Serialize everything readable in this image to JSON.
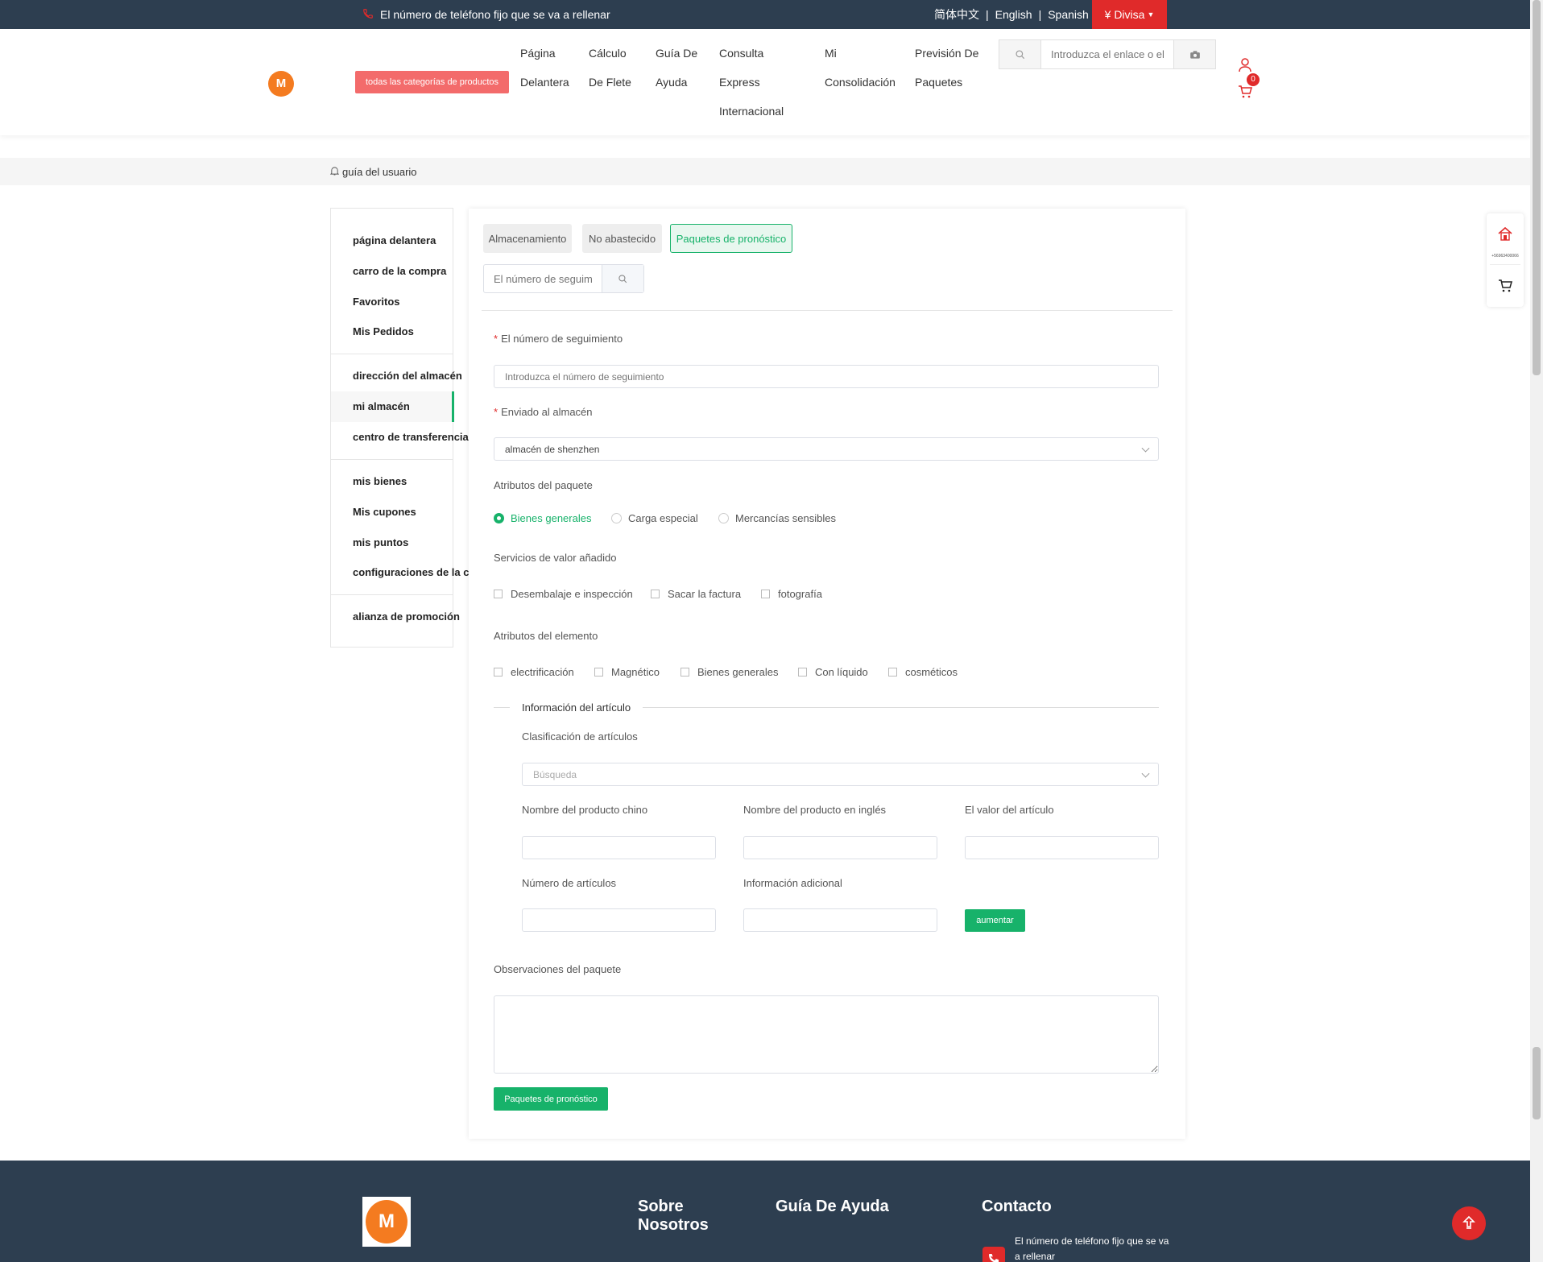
{
  "topbar": {
    "phone_text": "El número de teléfono fijo que se va a rellenar",
    "lang_zh": "简体中文",
    "lang_en": "English",
    "lang_es": "Spanish",
    "currency": "¥ Divisa"
  },
  "header": {
    "all_categories": "todas las categorías de productos",
    "nav": [
      {
        "line1": "Página",
        "line2": "Delantera",
        "line3": ""
      },
      {
        "line1": "Cálculo",
        "line2": "De Flete",
        "line3": ""
      },
      {
        "line1": "Guía De",
        "line2": "Ayuda",
        "line3": ""
      },
      {
        "line1": "Consulta",
        "line2": "Express",
        "line3": "Internacional"
      },
      {
        "line1": "Mi",
        "line2": "Consolidación",
        "line3": ""
      },
      {
        "line1": "Previsión De",
        "line2": "Paquetes",
        "line3": ""
      }
    ],
    "search_placeholder": "Introduzca el enlace o el",
    "cart_count": "0"
  },
  "breadcrumb": {
    "label": "guía del usuario"
  },
  "sidebar": {
    "items": [
      "página delantera",
      "carro de la compra",
      "Favoritos",
      "Mis Pedidos",
      "dirección del almacén",
      "mi almacén",
      "centro de transferencia",
      "mis bienes",
      "Mis cupones",
      "mis puntos",
      "configuraciones de la cuenta",
      "alianza de promoción"
    ],
    "active": "mi almacén"
  },
  "tabs": [
    "Almacenamiento",
    "No abastecido",
    "Paquetes de pronóstico"
  ],
  "tracking_search_placeholder": "El número de seguim",
  "form": {
    "tracking_label": "El número de seguimiento",
    "tracking_placeholder": "Introduzca el número de seguimiento",
    "warehouse_label": "Enviado al almacén",
    "warehouse_value": "almacén de shenzhen",
    "package_attr_label": "Atributos del paquete",
    "package_attrs": [
      "Bienes generales",
      "Carga especial",
      "Mercancías sensibles"
    ],
    "package_attr_selected": "Bienes generales",
    "services_label": "Servicios de valor añadido",
    "services": [
      "Desembalaje e inspección",
      "Sacar la factura",
      "fotografía"
    ],
    "item_attr_label": "Atributos del elemento",
    "item_attrs": [
      "electrificación",
      "Magnético",
      "Bienes generales",
      "Con líquido",
      "cosméticos"
    ],
    "item_info_title": "Información del artículo",
    "classification_label": "Clasificación de artículos",
    "classification_placeholder": "Búsqueda",
    "cn_name_label": "Nombre del producto chino",
    "en_name_label": "Nombre del producto en inglés",
    "value_label": "El valor del artículo",
    "qty_label": "Número de artículos",
    "extra_label": "Información adicional",
    "add_button": "aumentar",
    "remarks_label": "Observaciones del paquete",
    "submit_button": "Paquetes de pronóstico"
  },
  "float_panel": {
    "phone_small": "+56963400066"
  },
  "footer": {
    "about": "Sobre Nosotros",
    "help": "Guía De Ayuda",
    "contact": "Contacto",
    "contact_phone": "El número de teléfono fijo que se va a rellenar"
  },
  "colors": {
    "accent_green": "#17b26a",
    "accent_red": "#e02a2a",
    "dark_bar": "#2d3e50"
  }
}
